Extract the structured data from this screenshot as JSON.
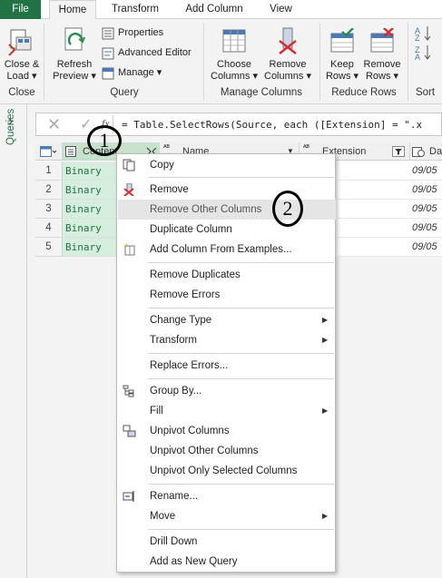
{
  "tabs": [
    {
      "label": "File"
    },
    {
      "label": "Home"
    },
    {
      "label": "Transform"
    },
    {
      "label": "Add Column"
    },
    {
      "label": "View"
    }
  ],
  "ribbon": {
    "close_load": {
      "line1": "Close &",
      "line2": "Load ▾"
    },
    "refresh_preview": {
      "line1": "Refresh",
      "line2": "Preview ▾"
    },
    "properties": "Properties",
    "advanced_editor": "Advanced Editor",
    "manage": "Manage ▾",
    "choose_columns": {
      "line1": "Choose",
      "line2": "Columns ▾"
    },
    "remove_columns": {
      "line1": "Remove",
      "line2": "Columns ▾"
    },
    "keep_rows": {
      "line1": "Keep",
      "line2": "Rows ▾"
    },
    "remove_rows": {
      "line1": "Remove",
      "line2": "Rows ▾"
    },
    "groups": {
      "close": "Close",
      "query": "Query",
      "manage_columns": "Manage Columns",
      "reduce_rows": "Reduce Rows",
      "sort": "Sort"
    }
  },
  "left_pane": {
    "label": "Queries",
    "chevron": "›"
  },
  "formula_bar": {
    "fx": "fx",
    "text": "= Table.SelectRows(Source, each ([Extension] = \".x"
  },
  "grid": {
    "headers": {
      "content": "Content",
      "name": "Name",
      "extension": "Extension",
      "date": "Da"
    },
    "rows": [
      {
        "num": "1",
        "content": "Binary",
        "date": "09/05"
      },
      {
        "num": "2",
        "content": "Binary",
        "date": "09/05"
      },
      {
        "num": "3",
        "content": "Binary",
        "date": "09/05"
      },
      {
        "num": "4",
        "content": "Binary",
        "date": "09/05"
      },
      {
        "num": "5",
        "content": "Binary",
        "date": "09/05"
      }
    ]
  },
  "menu": {
    "copy": "Copy",
    "remove": "Remove",
    "remove_other": "Remove Other Columns",
    "duplicate": "Duplicate Column",
    "add_from_examples": "Add Column From Examples...",
    "remove_duplicates": "Remove Duplicates",
    "remove_errors": "Remove Errors",
    "change_type": "Change Type",
    "transform": "Transform",
    "replace_errors": "Replace Errors...",
    "group_by": "Group By...",
    "fill": "Fill",
    "unpivot": "Unpivot Columns",
    "unpivot_other": "Unpivot Other Columns",
    "unpivot_selected": "Unpivot Only Selected Columns",
    "rename": "Rename...",
    "move": "Move",
    "drill_down": "Drill Down",
    "add_new_query": "Add as New Query"
  },
  "annotations": {
    "one": "1",
    "two": "2"
  },
  "colors": {
    "accent_green": "#217346",
    "selected_cell": "#d6eedd",
    "menu_highlight": "#e5e5e5"
  }
}
